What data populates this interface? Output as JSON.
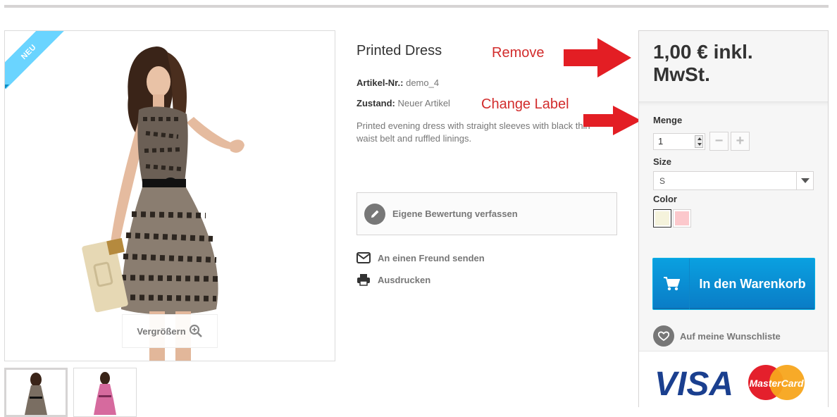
{
  "product": {
    "ribbon": "NEU",
    "title": "Printed Dress",
    "ref_label": "Artikel-Nr.:",
    "ref_value": "demo_4",
    "cond_label": "Zustand:",
    "cond_value": "Neuer Artikel",
    "description": "Printed evening dress with straight sleeves with black thin waist belt and ruffled linings.",
    "zoom_label": "Vergrößern"
  },
  "actions": {
    "review": "Eigene Bewertung verfassen",
    "send_friend": "An einen Freund senden",
    "print": "Ausdrucken"
  },
  "annotations": {
    "remove": "Remove",
    "change_label": "Change Label",
    "color": "#d22c2c"
  },
  "buy": {
    "price": "1,00 € inkl. MwSt.",
    "qty_label": "Menge",
    "qty_value": "1",
    "minus": "−",
    "plus": "+",
    "size_label": "Size",
    "size_value": "S",
    "color_label": "Color",
    "colors": [
      "#f5f3dc",
      "#fcc8cc"
    ],
    "cart_label": "In den Warenkorb",
    "wishlist": "Auf meine Wunschliste",
    "accent": "#0a8dd6"
  },
  "payment": {
    "visa": "VISA",
    "mastercard": "MasterCard"
  },
  "icons": [
    "pencil-icon",
    "envelope-icon",
    "printer-icon",
    "zoom-in-icon",
    "cart-icon",
    "heart-icon"
  ]
}
